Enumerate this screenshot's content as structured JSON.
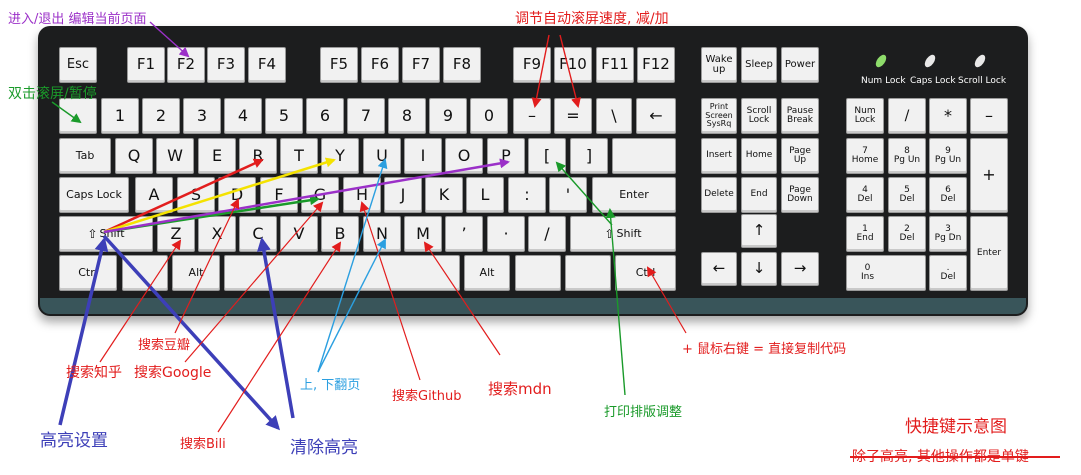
{
  "colors": {
    "purple": "#9b30c8",
    "red": "#e21d1d",
    "green": "#1a9a2a",
    "yellow": "#f4e200",
    "blue": "#2b9fe0",
    "navy": "#3d3fb8",
    "keyboard_body": "#1c1d1e",
    "key_face": "#f1f1f1",
    "led_text": "#ffffff"
  },
  "keys": {
    "esc": "Esc",
    "f1": "F1",
    "f2": "F2",
    "f3": "F3",
    "f4": "F4",
    "f5": "F5",
    "f6": "F6",
    "f7": "F7",
    "f8": "F8",
    "f9": "F9",
    "f10": "F10",
    "f11": "F11",
    "f12": "F12",
    "wake": "Wake\nup",
    "sleep": "Sleep",
    "power": "Power",
    "backtick": "",
    "1": "1",
    "2": "2",
    "3": "3",
    "4": "4",
    "5": "5",
    "6": "6",
    "7": "7",
    "8": "8",
    "9": "9",
    "0": "0",
    "minus": "–",
    "equals": "=",
    "backslash": "\\",
    "backspace": "←",
    "tab": "Tab",
    "q": "Q",
    "w": "W",
    "e": "E",
    "r": "R",
    "t": "T",
    "y": "Y",
    "u": "U",
    "i": "I",
    "o": "O",
    "p": "P",
    "lbracket": "[",
    "rbracket": "]",
    "caps": "Caps Lock",
    "a": "A",
    "s": "S",
    "d": "D",
    "f": "F",
    "g": "G",
    "h": "H",
    "j": "J",
    "k": "K",
    "l": "L",
    "colon": ":",
    "quote": "'",
    "enter": "Enter",
    "lshift": "Shift",
    "z": "Z",
    "x": "X",
    "c": "C",
    "v": "V",
    "b": "B",
    "n": "N",
    "m": "M",
    "comma": "’",
    "period": "·",
    "slash": "/",
    "rshift": "Shift",
    "lctrl": "Ctrl",
    "lwin": "",
    "lalt": "Alt",
    "space": "",
    "ralt": "Alt",
    "rwin": "",
    "rctrl": "Ctrl",
    "prtsc": "Print\nScreen\nSysRq",
    "scroll": "Scroll\nLock",
    "pause": "Pause\nBreak",
    "insert": "Insert",
    "home": "Home",
    "pgup": "Page\nUp",
    "delete": "Delete",
    "end": "End",
    "pgdn": "Page\nDown",
    "arrow_up": "↑",
    "arrow_left": "←",
    "arrow_down": "↓",
    "arrow_right": "→",
    "numlock": "Num\nLock",
    "num_div": "/",
    "num_mul": "*",
    "num_sub": "–",
    "num7": "7\nHome",
    "num8": "8\nPg Un",
    "num9": "9\nPg Un",
    "num_add": "+",
    "num4": "4\nDel",
    "num5": "5\nDel",
    "num6": "6\nDel",
    "num1": "1\nEnd",
    "num2": "2\nDel",
    "num3": "3\nPg Dn",
    "num_enter": "Enter",
    "num0": "0\nIns",
    "num_del": ".\nDel"
  },
  "leds": {
    "num": "Num Lock",
    "caps": "Caps Lock",
    "scroll": "Scroll Lock"
  },
  "annotations": {
    "enter_exit_edit": "进入/退出 编辑当前页面",
    "scroll_speed": "调节自动滚屏速度, 减/加",
    "dblclick_scroll": "双击滚屏/暂停",
    "search_douban": "搜索豆瓣",
    "search_zhihu": "搜索知乎",
    "search_google": "搜索Google",
    "search_bili": "搜索Bili",
    "highlight_settings": "高亮设置",
    "clear_highlight": "清除高亮",
    "page_updown": "上, 下翻页",
    "search_github": "搜索Github",
    "search_mdn": "搜索mdn",
    "print_layout": "打印排版调整",
    "right_click_copy": "+ 鼠标右键 = 直接复制代码",
    "legend_title": "快捷键示意图",
    "legend_struck": "除了高亮, 其他操作都是单键"
  }
}
